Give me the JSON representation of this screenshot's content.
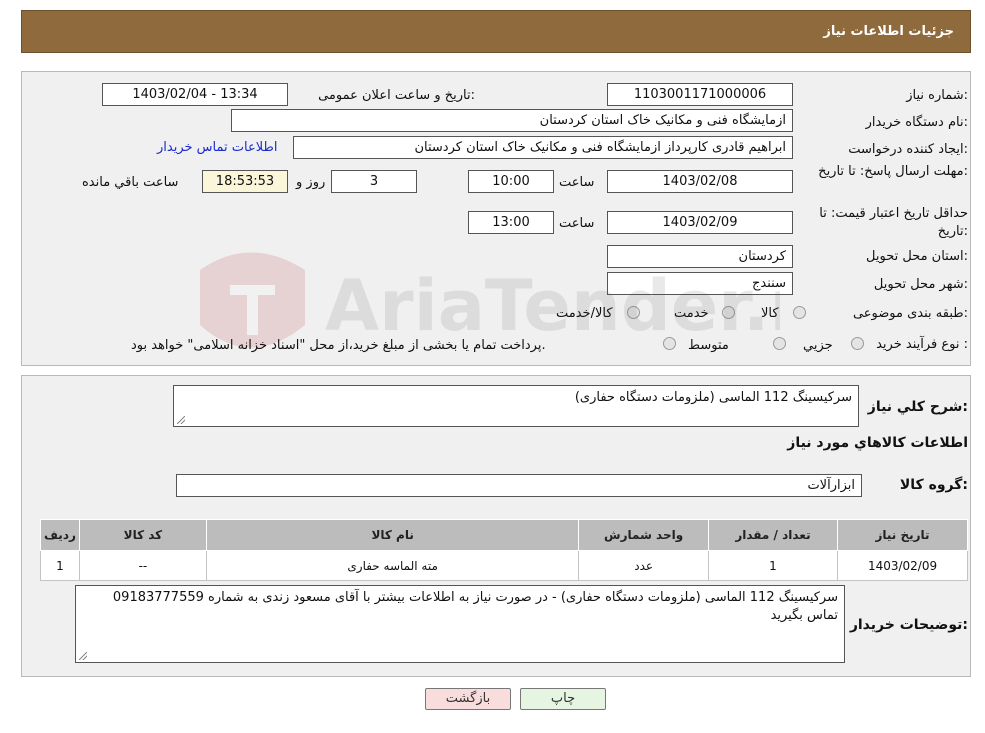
{
  "header": {
    "title": "جزئیات اطلاعات نیاز"
  },
  "form": {
    "need_number_label": "شماره نیاز:",
    "need_number": "1103001171000006",
    "announce_label": "تاریخ و ساعت اعلان عمومی:",
    "announce_value": "1403/02/04 - 13:34",
    "buyer_org_label": "نام دستگاه خریدار:",
    "buyer_org": "ازمایشگاه فنی و مکانیک خاک استان کردستان",
    "creator_label": "ایجاد کننده درخواست:",
    "creator": "ابراهیم قادری کارپرداز ازمایشگاه فنی و مکانیک خاک استان کردستان",
    "contact_link": "اطلاعات تماس خریدار",
    "deadline_label": "مهلت ارسال پاسخ: تا تاریخ:",
    "deadline_date": "1403/02/08",
    "time_label": "ساعت",
    "deadline_time": "10:00",
    "days_value": "3",
    "days_label": "روز و",
    "remaining_time": "18:53:53",
    "remaining_label": "ساعت باقي مانده",
    "validity_label": "حداقل تاریخ اعتبار قیمت: تا تاریخ:",
    "validity_date": "1403/02/09",
    "validity_time": "13:00",
    "province_label": "استان محل تحویل:",
    "province": "کردستان",
    "city_label": "شهر محل تحویل:",
    "city": "سنندج",
    "category_label": "طبقه بندی موضوعی:",
    "category_options": [
      "کالا",
      "خدمت",
      "کالا/خدمت"
    ],
    "process_label": "نوع فرآیند خرید :",
    "process_options": [
      "جزیي",
      "متوسط"
    ],
    "process_note": "پرداخت تمام یا بخشی از مبلغ خرید،از محل \"اسناد خزانه اسلامی\" خواهد بود."
  },
  "details": {
    "summary_label": "شرح کلي نیاز:",
    "summary": "سرکیسینگ 112 الماسی (ملزومات دستگاه حفاری)",
    "goods_title": "اطلاعات کالاهاي مورد نیاز",
    "group_label": "گروه کالا:",
    "group": "ابزارآلات",
    "table": {
      "headers": [
        "ردیف",
        "کد کالا",
        "نام کالا",
        "واحد شمارش",
        "تعداد / مقدار",
        "تاریخ نیاز"
      ],
      "rows": [
        [
          "1",
          "--",
          "مته الماسه حفاری",
          "عدد",
          "1",
          "1403/02/09"
        ]
      ]
    },
    "buyer_notes_label": "توضیحات خریدار:",
    "buyer_notes": "سرکیسینگ 112 الماسی (ملزومات دستگاه حفاری) - در صورت نیاز به اطلاعات بیشتر با آقای مسعود زندی به شماره 09183777559 تماس بگیرید"
  },
  "buttons": {
    "print": "چاپ",
    "back": "بازگشت"
  },
  "watermark": {
    "text": "AriaTender.neT"
  },
  "colors": {
    "header": "#8e6a3c",
    "link": "#1a2bd0",
    "back_button": "#f9dcdc"
  }
}
